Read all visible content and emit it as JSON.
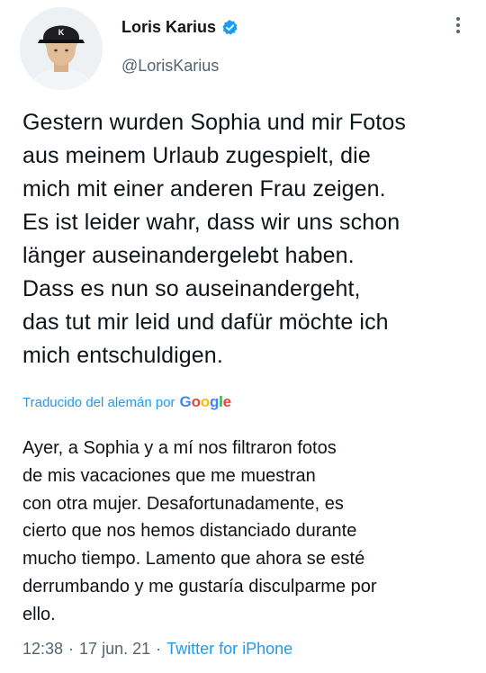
{
  "author": {
    "display_name": "Loris Karius",
    "handle": "@LorisKarius",
    "verified": true,
    "verified_color": "#1d9bf0",
    "avatar_icon": "user-avatar-photo"
  },
  "tweet": {
    "text": "Gestern wurden Sophia und mir Fotos\naus meinem Urlaub zugespielt, die\nmich mit einer anderen Frau zeigen.\nEs ist leider wahr, dass wir uns schon\nlänger auseinandergelebt haben.\nDass es nun so auseinandergeht,\ndas tut mir leid und dafür möchte ich\nmich entschuldigen."
  },
  "translation": {
    "label": "Traducido del alemán por",
    "provider": {
      "G": "G",
      "o1": "o",
      "o2": "o",
      "g": "g",
      "l": "l",
      "e": "e"
    },
    "text": "Ayer, a Sophia y a mí nos filtraron fotos\nde mis vacaciones que me muestran\ncon otra mujer. Desafortunadamente, es\ncierto que nos hemos distanciado durante\nmucho tiempo. Lamento que ahora se esté\nderrumbando y me gustaría disculparme por\nello."
  },
  "meta": {
    "time": "12:38",
    "separator": "·",
    "date": "17 jun. 21",
    "source": "Twitter for iPhone"
  },
  "colors": {
    "text": "#0f1419",
    "secondary": "#536471",
    "link": "#1d9bf0"
  }
}
